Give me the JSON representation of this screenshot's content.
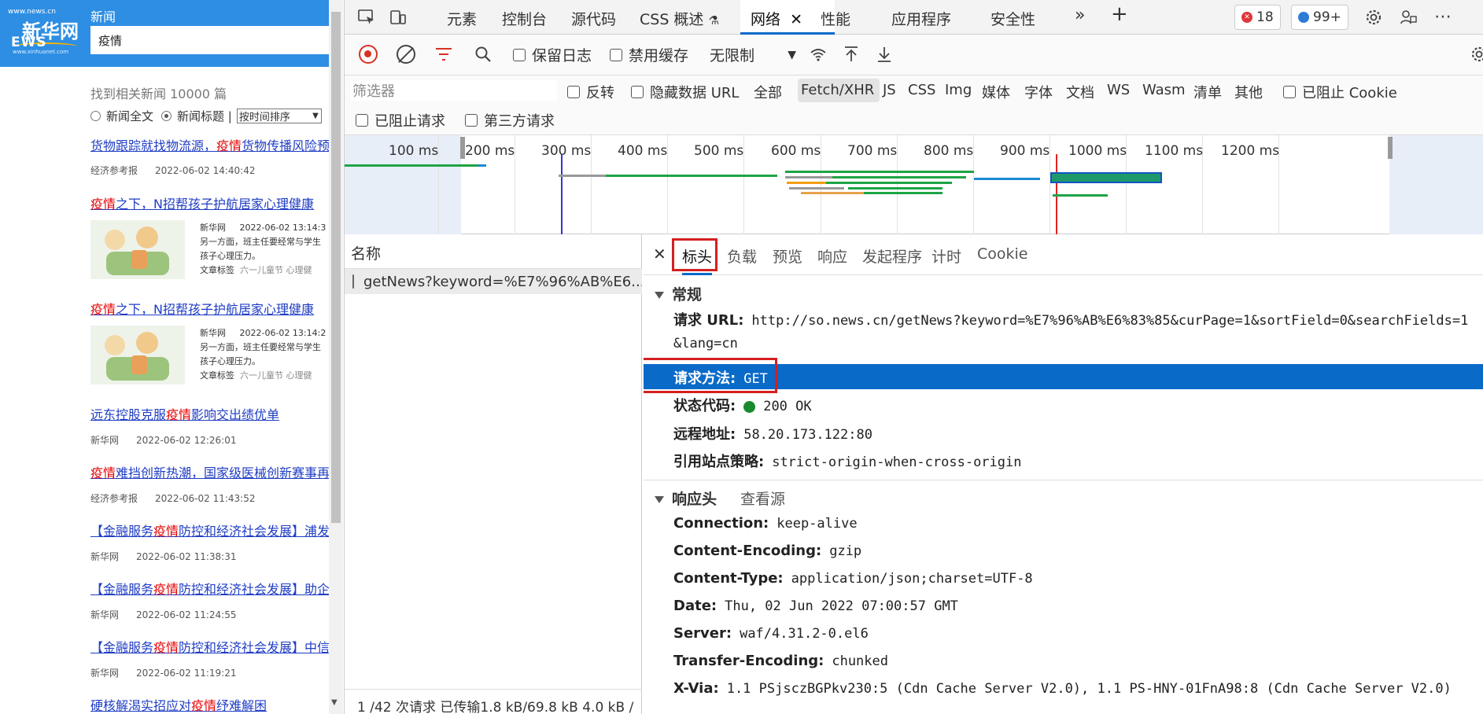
{
  "news": {
    "logo_url": "www.news.cn",
    "logo_text": "新华网",
    "logo_ews": "EWS",
    "logo_sub": "www.xinhuanet.com",
    "tab_label": "新闻",
    "search_value": "疫情",
    "result_count": "找到相关新闻  10000  篇",
    "opt_full": "新闻全文",
    "opt_title": "新闻标题 |",
    "sort_value": "按时间排序",
    "items": [
      {
        "pre": "货物跟踪就找物流源，",
        "kw": "疫情",
        "post": "货物传播风险预",
        "source": "经济参考报",
        "time": "2022-06-02 14:40:42"
      },
      {
        "pre": "",
        "kw": "疫情",
        "post": "之下，N招帮孩子护航居家心理健康",
        "source": "新华网",
        "time": "2022-06-02 13:14:3",
        "l1": "另一方面，班主任要经常与学生",
        "l2": "孩子心理压力。",
        "tag_label": "文章标签",
        "tags": "六一儿童节  心理健"
      },
      {
        "pre": "",
        "kw": "疫情",
        "post": "之下，N招帮孩子护航居家心理健康",
        "source": "新华网",
        "time": "2022-06-02 13:14:2",
        "l1": "另一方面，班主任要经常与学生",
        "l2": "孩子心理压力。",
        "tag_label": "文章标签",
        "tags": "六一儿童节  心理健"
      },
      {
        "pre": "远东控股克服",
        "kw": "疫情",
        "post": "影响交出绩优单",
        "source": "新华网",
        "time": "2022-06-02 12:26:01"
      },
      {
        "pre": "",
        "kw": "疫情",
        "post": "难挡创新热潮，国家级医械创新赛事再",
        "source": "经济参考报",
        "time": "2022-06-02 11:43:52"
      },
      {
        "pre": "【金融服务",
        "kw": "疫情",
        "post": "防控和经济社会发展】浦发",
        "source": "新华网",
        "time": "2022-06-02 11:38:31"
      },
      {
        "pre": "【金融服务",
        "kw": "疫情",
        "post": "防控和经济社会发展】助企",
        "source": "新华网",
        "time": "2022-06-02 11:24:55"
      },
      {
        "pre": "【金融服务",
        "kw": "疫情",
        "post": "防控和经济社会发展】中信",
        "source": "新华网",
        "time": "2022-06-02 11:19:21"
      },
      {
        "pre": "硬核解渴实招应对",
        "kw": "疫情",
        "post": "纾难解困",
        "source": "",
        "time": ""
      }
    ]
  },
  "devtools": {
    "tabs": [
      "元素",
      "控制台",
      "源代码",
      "CSS 概述",
      "网络",
      "性能",
      "应用程序",
      "安全性"
    ],
    "active_tab": "网络",
    "errors": "18",
    "messages": "99+",
    "toolbar": {
      "preserve_log": "保留日志",
      "disable_cache": "禁用缓存",
      "throttle": "无限制"
    },
    "filter": {
      "placeholder": "筛选器",
      "invert": "反转",
      "hide_data_urls": "隐藏数据 URL",
      "types": [
        "全部",
        "Fetch/XHR",
        "JS",
        "CSS",
        "Img",
        "媒体",
        "字体",
        "文档",
        "WS",
        "Wasm",
        "清单",
        "其他"
      ],
      "selected_type": "Fetch/XHR",
      "blocked_cookies": "已阻止 Cookie",
      "blocked_requests": "已阻止请求",
      "third_party": "第三方请求"
    },
    "timeline_ticks": [
      "100 ms",
      "200 ms",
      "300 ms",
      "400 ms",
      "500 ms",
      "600 ms",
      "700 ms",
      "800 ms",
      "900 ms",
      "1000 ms",
      "1100 ms",
      "1200 ms"
    ],
    "request_list": {
      "header": "名称",
      "item": "getNews?keyword=%E7%96%AB%E6...",
      "status": "1 /42 次请求  已传输1.8 kB/69.8 kB  4.0 kB /"
    },
    "detail": {
      "tabs": [
        "标头",
        "负载",
        "预览",
        "响应",
        "发起程序",
        "计时",
        "Cookie"
      ],
      "active_tab": "标头",
      "general_title": "常规",
      "general": {
        "url_key": "请求 URL:",
        "url_val": "http://so.news.cn/getNews?keyword=%E7%96%AB%E6%83%85&curPage=1&sortField=0&searchFields=1",
        "url_val2": "&lang=cn",
        "method_key": "请求方法:",
        "method_val": "GET",
        "status_key": "状态代码:",
        "status_val": "200 OK",
        "remote_key": "远程地址:",
        "remote_val": "58.20.173.122:80",
        "referrer_key": "引用站点策略:",
        "referrer_val": "strict-origin-when-cross-origin"
      },
      "response_title": "响应头",
      "view_source": "查看源",
      "response_headers": [
        {
          "k": "Connection:",
          "v": "keep-alive"
        },
        {
          "k": "Content-Encoding:",
          "v": "gzip"
        },
        {
          "k": "Content-Type:",
          "v": "application/json;charset=UTF-8"
        },
        {
          "k": "Date:",
          "v": "Thu, 02 Jun 2022 07:00:57 GMT"
        },
        {
          "k": "Server:",
          "v": "waf/4.31.2-0.el6"
        },
        {
          "k": "Transfer-Encoding:",
          "v": "chunked"
        },
        {
          "k": "X-Via:",
          "v": "1.1 PSjsczBGPkv230:5 (Cdn Cache Server V2.0), 1.1 PS-HNY-01FnA98:8 (Cdn Cache Server V2.0)"
        }
      ]
    }
  }
}
